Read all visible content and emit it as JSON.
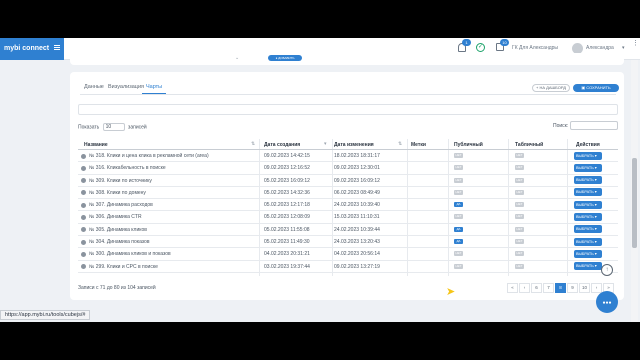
{
  "app": {
    "brand": "mybi connect"
  },
  "topbar": {
    "notifications_count": "1",
    "messages_count": "10",
    "company": "ГК Для Александры",
    "user": "Александра",
    "caret": "▾",
    "more": "⋮"
  },
  "upper": {
    "dropdown_caret": "⌄",
    "button": "● ДОБАВИТЬ"
  },
  "tabs": [
    {
      "label": "Данные"
    },
    {
      "label": "Визуализация"
    },
    {
      "label": "Чарты"
    }
  ],
  "buttons": {
    "dashboard": "+ НА ДАШБОРД",
    "save": "▣ СОХРАНИТЬ"
  },
  "list": {
    "show_label": "Показать",
    "show_value": "10",
    "entries_label": "записей",
    "search_label": "Поиск:"
  },
  "table": {
    "columns": [
      "Название",
      "Дата создания",
      "Дата изменения",
      "Метки",
      "Публичный",
      "Табличный",
      "Действия"
    ],
    "rows": [
      {
        "name": "№ 318. Клики и цена клика в рекламной сети (area)",
        "created": "09.02.2023 14:42:15",
        "updated": "18.02.2023 18:31:17",
        "public": "НЕТ",
        "tabular": "НЕТ",
        "public_on": false,
        "action": "ВЫБРАТЬ ▾"
      },
      {
        "name": "№ 316. Кликабельность в поиске",
        "created": "09.02.2023 12:16:52",
        "updated": "09.02.2023 12:30:01",
        "public": "НЕТ",
        "tabular": "НЕТ",
        "public_on": false,
        "action": "ВЫБРАТЬ ▾"
      },
      {
        "name": "№ 309. Клики по источнику",
        "created": "05.02.2023 16:09:12",
        "updated": "09.02.2023 16:09:12",
        "public": "НЕТ",
        "tabular": "НЕТ",
        "public_on": false,
        "action": "ВЫБРАТЬ ▾"
      },
      {
        "name": "№ 308. Клики по домену",
        "created": "05.02.2023 14:32:36",
        "updated": "06.02.2023 08:49:49",
        "public": "НЕТ",
        "tabular": "НЕТ",
        "public_on": false,
        "action": "ВЫБРАТЬ ▾"
      },
      {
        "name": "№ 307. Динамика расходов",
        "created": "05.02.2023 12:17:18",
        "updated": "24.02.2023 10:39:40",
        "public": "ДА",
        "tabular": "НЕТ",
        "public_on": true,
        "action": "ВЫБРАТЬ ▾"
      },
      {
        "name": "№ 306. Динамика CTR",
        "created": "05.02.2023 12:08:09",
        "updated": "15.03.2023 11:10:31",
        "public": "НЕТ",
        "tabular": "НЕТ",
        "public_on": false,
        "action": "ВЫБРАТЬ ▾"
      },
      {
        "name": "№ 305. Динамика кликов",
        "created": "05.02.2023 11:55:08",
        "updated": "24.02.2023 10:39:44",
        "public": "ДА",
        "tabular": "НЕТ",
        "public_on": true,
        "action": "ВЫБРАТЬ ▾"
      },
      {
        "name": "№ 304. Динамика показов",
        "created": "05.02.2023 11:49:30",
        "updated": "24.03.2023 13:20:43",
        "public": "ДА",
        "tabular": "НЕТ",
        "public_on": true,
        "action": "ВЫБРАТЬ ▾"
      },
      {
        "name": "№ 300. Динамика кликов и показов",
        "created": "04.02.2023 20:31:21",
        "updated": "04.02.2023 20:56:14",
        "public": "НЕТ",
        "tabular": "НЕТ",
        "public_on": false,
        "action": "ВЫБРАТЬ ▾"
      },
      {
        "name": "№ 299. Клики и CPC в поиске",
        "created": "03.02.2023 19:37:44",
        "updated": "09.02.2023 13:27:19",
        "public": "НЕТ",
        "tabular": "НЕТ",
        "public_on": false,
        "action": "ВЫБРАТЬ ▾"
      }
    ]
  },
  "footer": {
    "info": "Записи с 71 до 80 из 104 записей"
  },
  "pagination": {
    "pages": [
      "«",
      "‹",
      "6",
      "7",
      "8",
      "9",
      "10",
      "›",
      "»"
    ],
    "active": "8"
  },
  "fab": {
    "up": "↑",
    "chat": "●●●"
  },
  "status": {
    "url": "https://app.mybi.ru/tools/cubejs/#"
  },
  "colors": {
    "accent": "#2f80d1",
    "brand": "#2f80d1"
  }
}
